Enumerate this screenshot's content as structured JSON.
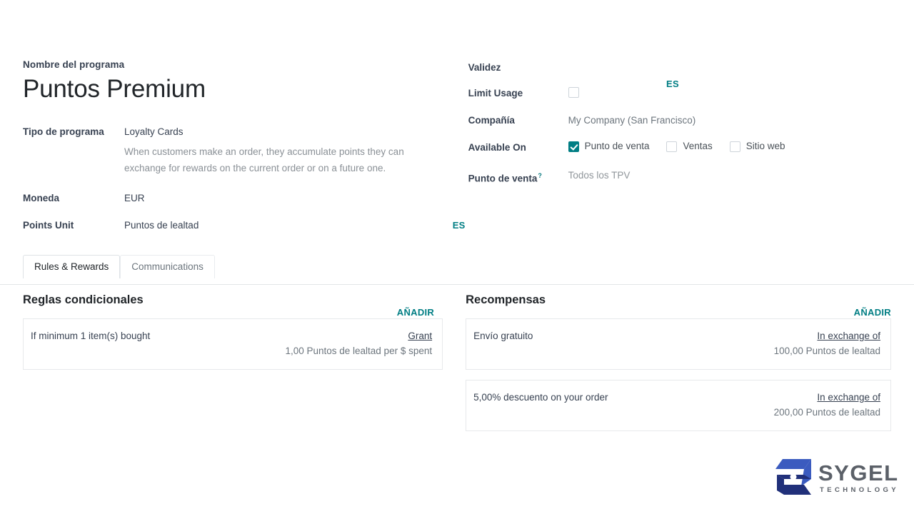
{
  "form": {
    "title_label": "Nombre del programa",
    "title_value": "Puntos Premium",
    "lang_badge_top": "ES",
    "lang_badge_points": "ES",
    "left_fields": {
      "program_type_label": "Tipo de programa",
      "program_type_value": "Loyalty Cards",
      "program_type_description": "When customers make an order, they accumulate points they can exchange for rewards on the current order or on a future one.",
      "currency_label": "Moneda",
      "currency_value": "EUR",
      "points_unit_label": "Points Unit",
      "points_unit_value": "Puntos de lealtad"
    },
    "right_fields": {
      "validity_label": "Validez",
      "validity_value": "",
      "limit_usage_label": "Limit Usage",
      "limit_usage_checked": false,
      "company_label": "Compañía",
      "company_value": "My Company (San Francisco)",
      "available_on_label": "Available On",
      "available_on": [
        {
          "label": "Punto de venta",
          "checked": true
        },
        {
          "label": "Ventas",
          "checked": false
        },
        {
          "label": "Sitio web",
          "checked": false
        }
      ],
      "pos_label": "Punto de venta",
      "pos_help": "?",
      "pos_value": "Todos los TPV"
    }
  },
  "tabs": [
    {
      "label": "Rules & Rewards",
      "active": true
    },
    {
      "label": "Communications",
      "active": false
    }
  ],
  "rules_section": {
    "title": "Reglas condicionales",
    "add_label": "AÑADIR",
    "items": [
      {
        "condition": "If minimum 1 item(s) bought",
        "action_label": "Grant",
        "action_value": "1,00 Puntos de lealtad per $ spent"
      }
    ]
  },
  "rewards_section": {
    "title": "Recompensas",
    "add_label": "AÑADIR",
    "items": [
      {
        "name": "Envío gratuito",
        "action_label": "In exchange of",
        "action_value": "100,00 Puntos de lealtad"
      },
      {
        "name": "5,00% descuento on your order",
        "action_label": "In exchange of",
        "action_value": "200,00 Puntos de lealtad"
      }
    ]
  },
  "logo": {
    "name": "SYGEL",
    "subtitle": "TECHNOLOGY",
    "mark_color_light": "#3b5bbf",
    "mark_color_dark": "#21307a",
    "text_color": "#5b6068"
  },
  "colors": {
    "accent_teal": "#017e84",
    "label_text": "#374151",
    "muted_text": "#6c757d",
    "border": "#e7e9eb"
  }
}
